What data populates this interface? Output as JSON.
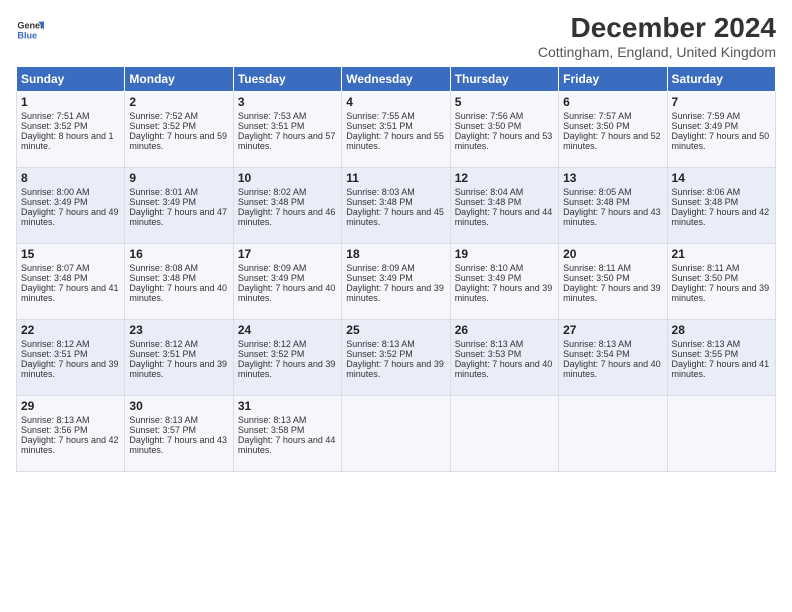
{
  "header": {
    "logo_line1": "General",
    "logo_line2": "Blue",
    "month": "December 2024",
    "location": "Cottingham, England, United Kingdom"
  },
  "days_of_week": [
    "Sunday",
    "Monday",
    "Tuesday",
    "Wednesday",
    "Thursday",
    "Friday",
    "Saturday"
  ],
  "weeks": [
    [
      {
        "day": "1",
        "sunrise": "Sunrise: 7:51 AM",
        "sunset": "Sunset: 3:52 PM",
        "daylight": "Daylight: 8 hours and 1 minute."
      },
      {
        "day": "2",
        "sunrise": "Sunrise: 7:52 AM",
        "sunset": "Sunset: 3:52 PM",
        "daylight": "Daylight: 7 hours and 59 minutes."
      },
      {
        "day": "3",
        "sunrise": "Sunrise: 7:53 AM",
        "sunset": "Sunset: 3:51 PM",
        "daylight": "Daylight: 7 hours and 57 minutes."
      },
      {
        "day": "4",
        "sunrise": "Sunrise: 7:55 AM",
        "sunset": "Sunset: 3:51 PM",
        "daylight": "Daylight: 7 hours and 55 minutes."
      },
      {
        "day": "5",
        "sunrise": "Sunrise: 7:56 AM",
        "sunset": "Sunset: 3:50 PM",
        "daylight": "Daylight: 7 hours and 53 minutes."
      },
      {
        "day": "6",
        "sunrise": "Sunrise: 7:57 AM",
        "sunset": "Sunset: 3:50 PM",
        "daylight": "Daylight: 7 hours and 52 minutes."
      },
      {
        "day": "7",
        "sunrise": "Sunrise: 7:59 AM",
        "sunset": "Sunset: 3:49 PM",
        "daylight": "Daylight: 7 hours and 50 minutes."
      }
    ],
    [
      {
        "day": "8",
        "sunrise": "Sunrise: 8:00 AM",
        "sunset": "Sunset: 3:49 PM",
        "daylight": "Daylight: 7 hours and 49 minutes."
      },
      {
        "day": "9",
        "sunrise": "Sunrise: 8:01 AM",
        "sunset": "Sunset: 3:49 PM",
        "daylight": "Daylight: 7 hours and 47 minutes."
      },
      {
        "day": "10",
        "sunrise": "Sunrise: 8:02 AM",
        "sunset": "Sunset: 3:48 PM",
        "daylight": "Daylight: 7 hours and 46 minutes."
      },
      {
        "day": "11",
        "sunrise": "Sunrise: 8:03 AM",
        "sunset": "Sunset: 3:48 PM",
        "daylight": "Daylight: 7 hours and 45 minutes."
      },
      {
        "day": "12",
        "sunrise": "Sunrise: 8:04 AM",
        "sunset": "Sunset: 3:48 PM",
        "daylight": "Daylight: 7 hours and 44 minutes."
      },
      {
        "day": "13",
        "sunrise": "Sunrise: 8:05 AM",
        "sunset": "Sunset: 3:48 PM",
        "daylight": "Daylight: 7 hours and 43 minutes."
      },
      {
        "day": "14",
        "sunrise": "Sunrise: 8:06 AM",
        "sunset": "Sunset: 3:48 PM",
        "daylight": "Daylight: 7 hours and 42 minutes."
      }
    ],
    [
      {
        "day": "15",
        "sunrise": "Sunrise: 8:07 AM",
        "sunset": "Sunset: 3:48 PM",
        "daylight": "Daylight: 7 hours and 41 minutes."
      },
      {
        "day": "16",
        "sunrise": "Sunrise: 8:08 AM",
        "sunset": "Sunset: 3:48 PM",
        "daylight": "Daylight: 7 hours and 40 minutes."
      },
      {
        "day": "17",
        "sunrise": "Sunrise: 8:09 AM",
        "sunset": "Sunset: 3:49 PM",
        "daylight": "Daylight: 7 hours and 40 minutes."
      },
      {
        "day": "18",
        "sunrise": "Sunrise: 8:09 AM",
        "sunset": "Sunset: 3:49 PM",
        "daylight": "Daylight: 7 hours and 39 minutes."
      },
      {
        "day": "19",
        "sunrise": "Sunrise: 8:10 AM",
        "sunset": "Sunset: 3:49 PM",
        "daylight": "Daylight: 7 hours and 39 minutes."
      },
      {
        "day": "20",
        "sunrise": "Sunrise: 8:11 AM",
        "sunset": "Sunset: 3:50 PM",
        "daylight": "Daylight: 7 hours and 39 minutes."
      },
      {
        "day": "21",
        "sunrise": "Sunrise: 8:11 AM",
        "sunset": "Sunset: 3:50 PM",
        "daylight": "Daylight: 7 hours and 39 minutes."
      }
    ],
    [
      {
        "day": "22",
        "sunrise": "Sunrise: 8:12 AM",
        "sunset": "Sunset: 3:51 PM",
        "daylight": "Daylight: 7 hours and 39 minutes."
      },
      {
        "day": "23",
        "sunrise": "Sunrise: 8:12 AM",
        "sunset": "Sunset: 3:51 PM",
        "daylight": "Daylight: 7 hours and 39 minutes."
      },
      {
        "day": "24",
        "sunrise": "Sunrise: 8:12 AM",
        "sunset": "Sunset: 3:52 PM",
        "daylight": "Daylight: 7 hours and 39 minutes."
      },
      {
        "day": "25",
        "sunrise": "Sunrise: 8:13 AM",
        "sunset": "Sunset: 3:52 PM",
        "daylight": "Daylight: 7 hours and 39 minutes."
      },
      {
        "day": "26",
        "sunrise": "Sunrise: 8:13 AM",
        "sunset": "Sunset: 3:53 PM",
        "daylight": "Daylight: 7 hours and 40 minutes."
      },
      {
        "day": "27",
        "sunrise": "Sunrise: 8:13 AM",
        "sunset": "Sunset: 3:54 PM",
        "daylight": "Daylight: 7 hours and 40 minutes."
      },
      {
        "day": "28",
        "sunrise": "Sunrise: 8:13 AM",
        "sunset": "Sunset: 3:55 PM",
        "daylight": "Daylight: 7 hours and 41 minutes."
      }
    ],
    [
      {
        "day": "29",
        "sunrise": "Sunrise: 8:13 AM",
        "sunset": "Sunset: 3:56 PM",
        "daylight": "Daylight: 7 hours and 42 minutes."
      },
      {
        "day": "30",
        "sunrise": "Sunrise: 8:13 AM",
        "sunset": "Sunset: 3:57 PM",
        "daylight": "Daylight: 7 hours and 43 minutes."
      },
      {
        "day": "31",
        "sunrise": "Sunrise: 8:13 AM",
        "sunset": "Sunset: 3:58 PM",
        "daylight": "Daylight: 7 hours and 44 minutes."
      },
      null,
      null,
      null,
      null
    ]
  ]
}
